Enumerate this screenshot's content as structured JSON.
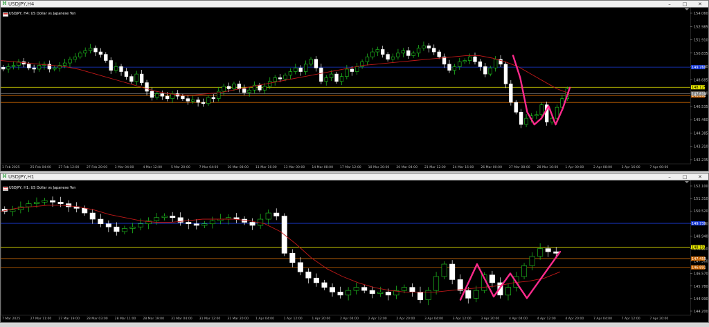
{
  "windows": [
    {
      "title": "USDJPY,H4",
      "symbol_label": "USDJPY, H4:  US Dollar vs Japanese Yen",
      "price_ticks": [
        "154.060",
        "152.985",
        "151.910",
        "150.835",
        "149.760",
        "148.685",
        "147.610",
        "146.535",
        "145.460",
        "144.385",
        "143.310",
        "142.235"
      ],
      "price_tags": [
        {
          "label": "149.760",
          "color": "#1a3bd6",
          "text_color": "#ffffff"
        },
        {
          "label": "148.125",
          "color": "#e8e800",
          "text_color": "#000000"
        },
        {
          "label": "147.453",
          "color": "#c86400",
          "text_color": "#ffffff"
        },
        {
          "label": "146.891",
          "color": "#c86400",
          "text_color": "#ffffff"
        },
        {
          "label": "147.610",
          "color": "#808080",
          "text_color": "#ffffff"
        }
      ],
      "time_labels": [
        "1 Feb 2025",
        "25 Feb 04:00",
        "27 Feb 12:00",
        "27 Feb 20:00",
        "3 Mar 04:00",
        "4 Mar 12:00",
        "5 Mar 20:00",
        "7 Mar 04:00",
        "10 Mar 08:00",
        "11 Mar 16:00",
        "13 Mar 00:00",
        "14 Mar 08:00",
        "17 Mar 12:00",
        "18 Mar 20:00",
        "20 Mar 04:00",
        "21 Mar 12:00",
        "24 Mar 16:00",
        "26 Mar 00:00",
        "27 Mar 08:00",
        "28 Mar 16:00",
        "1 Apr 00:00",
        "2 Apr 08:00",
        "3 Apr 16:00",
        "7 Apr 00:00"
      ]
    },
    {
      "title": "USDJPY,H1",
      "symbol_label": "USDJPY, H1:  US Dollar vs Japanese Yen",
      "price_ticks": [
        "152.100",
        "151.310",
        "150.520",
        "149.730",
        "148.940",
        "148.150",
        "147.360",
        "146.570",
        "145.780",
        "144.990",
        "144.200"
      ],
      "price_tags": [
        {
          "label": "149.730",
          "color": "#1a3bd6",
          "text_color": "#ffffff"
        },
        {
          "label": "148.192",
          "color": "#e8e800",
          "text_color": "#000000"
        },
        {
          "label": "147.453",
          "color": "#808080",
          "text_color": "#ffffff"
        },
        {
          "label": "147.455",
          "color": "#c86400",
          "text_color": "#ffffff"
        },
        {
          "label": "146.891",
          "color": "#c86400",
          "text_color": "#ffffff"
        }
      ],
      "time_labels": [
        "7 Mar 2025",
        "27 Mar 11:00",
        "27 Mar 19:00",
        "28 Mar 03:00",
        "28 Mar 11:00",
        "28 Mar 19:00",
        "31 Mar 04:00",
        "31 Mar 12:00",
        "31 Mar 20:00",
        "1 Apr 04:00",
        "1 Apr 12:00",
        "1 Apr 20:00",
        "2 Apr 04:00",
        "2 Apr 12:00",
        "2 Apr 20:00",
        "3 Apr 04:00",
        "3 Apr 12:00",
        "3 Apr 20:00",
        "4 Apr 04:00",
        "4 Apr 12:00",
        "4 Apr 20:00",
        "7 Apr 04:00",
        "7 Apr 12:00",
        "7 Apr 20:00"
      ]
    }
  ],
  "chart_data": [
    {
      "type": "candlestick",
      "title": "USDJPY, H4:  US Dollar vs Japanese Yen",
      "ylim": [
        141.9,
        154.6
      ],
      "closes": [
        149.6,
        149.8,
        149.9,
        150.2,
        150.0,
        149.7,
        149.6,
        149.9,
        150.0,
        149.6,
        149.7,
        149.9,
        150.1,
        150.4,
        150.6,
        150.9,
        151.1,
        151.3,
        151.0,
        150.8,
        150.3,
        149.5,
        149.8,
        149.4,
        149.0,
        148.6,
        149.2,
        148.5,
        147.8,
        147.3,
        147.6,
        147.4,
        147.2,
        147.6,
        147.4,
        147.2,
        147.0,
        147.1,
        146.9,
        146.8,
        147.3,
        147.2,
        147.8,
        148.2,
        148.0,
        148.4,
        148.0,
        147.7,
        147.9,
        148.3,
        147.9,
        148.2,
        148.6,
        148.9,
        148.8,
        149.1,
        149.4,
        149.7,
        149.4,
        150.0,
        150.4,
        149.7,
        148.6,
        148.9,
        149.2,
        148.6,
        149.0,
        149.6,
        149.4,
        149.8,
        150.2,
        150.6,
        151.0,
        151.2,
        150.8,
        150.4,
        150.6,
        150.9,
        151.1,
        150.7,
        150.9,
        151.3,
        151.5,
        151.3,
        151.0,
        150.6,
        150.0,
        149.5,
        149.8,
        150.2,
        150.3,
        150.6,
        150.2,
        149.8,
        149.2,
        149.7,
        150.4,
        150.0,
        148.4,
        146.9,
        146.1,
        145.1,
        145.6,
        145.8,
        145.9,
        146.7,
        145.3,
        145.6,
        146.5,
        147.2,
        148.0
      ],
      "ma": [
        150.3,
        150.2,
        150.1,
        150.0,
        149.9,
        149.8,
        149.6,
        149.3,
        149.0,
        148.7,
        148.4,
        148.1,
        147.8,
        147.6,
        147.5,
        147.5,
        147.6,
        147.7,
        147.9,
        148.1,
        148.3,
        148.5,
        148.7,
        148.9,
        149.1,
        149.3,
        149.5,
        149.7,
        149.9,
        150.0,
        150.1,
        150.2,
        150.3,
        150.4,
        150.5,
        150.6,
        150.7,
        150.7,
        150.5,
        150.2,
        149.8,
        149.2,
        148.6,
        148.0,
        147.6
      ],
      "horizontal_levels": [
        149.76,
        148.125,
        147.61,
        147.453,
        146.891
      ],
      "pattern_polyline": [
        150.7,
        148.9,
        146.1,
        145.1,
        145.6,
        146.6,
        145.1,
        146.4,
        148.1
      ]
    },
    {
      "type": "candlestick",
      "title": "USDJPY, H1:  US Dollar vs Japanese Yen",
      "ylim": [
        143.8,
        152.5
      ],
      "closes": [
        150.5,
        150.6,
        150.8,
        151.0,
        151.1,
        151.2,
        151.1,
        151.0,
        150.8,
        150.7,
        150.4,
        150.0,
        149.7,
        149.5,
        149.2,
        149.4,
        149.5,
        149.7,
        149.9,
        150.1,
        150.2,
        150.1,
        149.8,
        149.7,
        149.6,
        149.7,
        149.9,
        150.0,
        150.1,
        150.0,
        149.8,
        149.6,
        150.0,
        150.4,
        150.2,
        147.8,
        147.2,
        146.6,
        146.2,
        145.9,
        145.6,
        145.3,
        145.1,
        145.4,
        145.6,
        145.4,
        145.2,
        145.3,
        145.1,
        145.4,
        145.6,
        145.3,
        144.8,
        145.4,
        146.3,
        147.1,
        146.1,
        145.4,
        144.9,
        145.4,
        146.4,
        145.9,
        145.1,
        145.6,
        146.3,
        147.0,
        147.6,
        148.1,
        147.9,
        147.8
      ],
      "ma": [
        150.5,
        150.7,
        150.8,
        150.9,
        150.9,
        150.8,
        150.6,
        150.3,
        150.1,
        149.9,
        149.8,
        149.8,
        149.9,
        150.0,
        150.0,
        150.0,
        149.9,
        149.7,
        149.2,
        148.4,
        147.5,
        146.8,
        146.3,
        145.9,
        145.6,
        145.4,
        145.3,
        145.3,
        145.3,
        145.4,
        145.5,
        145.6,
        145.7,
        145.9,
        146.0,
        146.2,
        146.6
      ],
      "horizontal_levels": [
        149.73,
        148.192,
        147.453,
        147.455,
        146.891
      ],
      "pattern_polyline": [
        144.8,
        147.1,
        145.0,
        146.5,
        144.9,
        146.4,
        147.9
      ]
    }
  ]
}
